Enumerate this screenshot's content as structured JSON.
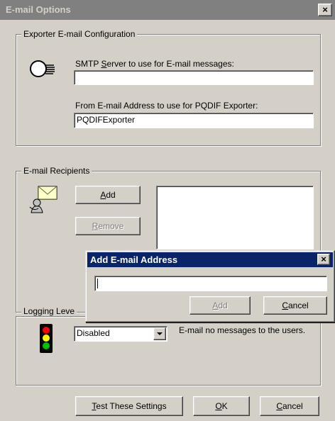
{
  "window": {
    "title": "E-mail Options",
    "close_glyph": "×"
  },
  "exporter_config": {
    "legend": "Exporter E-mail Configuration",
    "smtp_label_pre": "SMTP ",
    "smtp_label_accel": "S",
    "smtp_label_post": "erver to use for E-mail messages:",
    "smtp_value": "",
    "from_label": "From E-mail Address to use for PQDIF Exporter:",
    "from_value": "PQDIFExporter",
    "icon": "server-icon"
  },
  "recipients": {
    "legend": "E-mail Recipients",
    "add_accel": "A",
    "add_rest": "dd",
    "remove_accel": "R",
    "remove_rest": "emove",
    "icon": "mail-user-icon"
  },
  "logging": {
    "legend": "Logging Leve",
    "selected": "Disabled",
    "description": "E-mail no messages to the users.",
    "icon": "traffic-light-icon"
  },
  "footer": {
    "test_accel": "T",
    "test_rest": "est These Settings",
    "ok_accel": "O",
    "ok_rest": "K",
    "cancel_accel": "C",
    "cancel_rest": "ancel"
  },
  "add_dialog": {
    "title": "Add E-mail Address",
    "close_glyph": "×",
    "input_value": "",
    "add_accel": "A",
    "add_rest": "dd",
    "cancel_accel": "C",
    "cancel_rest": "ancel"
  }
}
